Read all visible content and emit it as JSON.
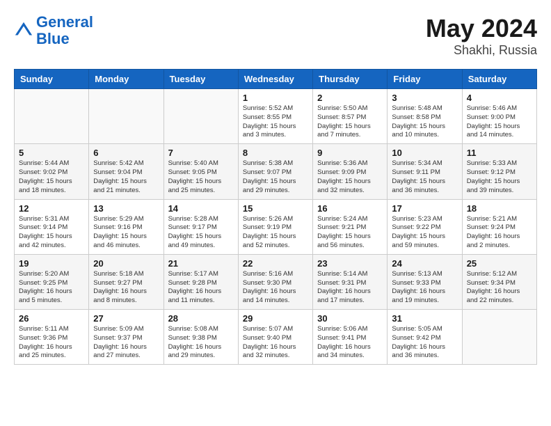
{
  "header": {
    "logo_line1": "General",
    "logo_line2": "Blue",
    "month": "May 2024",
    "location": "Shakhi, Russia"
  },
  "weekdays": [
    "Sunday",
    "Monday",
    "Tuesday",
    "Wednesday",
    "Thursday",
    "Friday",
    "Saturday"
  ],
  "weeks": [
    [
      {
        "day": "",
        "info": ""
      },
      {
        "day": "",
        "info": ""
      },
      {
        "day": "",
        "info": ""
      },
      {
        "day": "1",
        "info": "Sunrise: 5:52 AM\nSunset: 8:55 PM\nDaylight: 15 hours\nand 3 minutes."
      },
      {
        "day": "2",
        "info": "Sunrise: 5:50 AM\nSunset: 8:57 PM\nDaylight: 15 hours\nand 7 minutes."
      },
      {
        "day": "3",
        "info": "Sunrise: 5:48 AM\nSunset: 8:58 PM\nDaylight: 15 hours\nand 10 minutes."
      },
      {
        "day": "4",
        "info": "Sunrise: 5:46 AM\nSunset: 9:00 PM\nDaylight: 15 hours\nand 14 minutes."
      }
    ],
    [
      {
        "day": "5",
        "info": "Sunrise: 5:44 AM\nSunset: 9:02 PM\nDaylight: 15 hours\nand 18 minutes."
      },
      {
        "day": "6",
        "info": "Sunrise: 5:42 AM\nSunset: 9:04 PM\nDaylight: 15 hours\nand 21 minutes."
      },
      {
        "day": "7",
        "info": "Sunrise: 5:40 AM\nSunset: 9:05 PM\nDaylight: 15 hours\nand 25 minutes."
      },
      {
        "day": "8",
        "info": "Sunrise: 5:38 AM\nSunset: 9:07 PM\nDaylight: 15 hours\nand 29 minutes."
      },
      {
        "day": "9",
        "info": "Sunrise: 5:36 AM\nSunset: 9:09 PM\nDaylight: 15 hours\nand 32 minutes."
      },
      {
        "day": "10",
        "info": "Sunrise: 5:34 AM\nSunset: 9:11 PM\nDaylight: 15 hours\nand 36 minutes."
      },
      {
        "day": "11",
        "info": "Sunrise: 5:33 AM\nSunset: 9:12 PM\nDaylight: 15 hours\nand 39 minutes."
      }
    ],
    [
      {
        "day": "12",
        "info": "Sunrise: 5:31 AM\nSunset: 9:14 PM\nDaylight: 15 hours\nand 42 minutes."
      },
      {
        "day": "13",
        "info": "Sunrise: 5:29 AM\nSunset: 9:16 PM\nDaylight: 15 hours\nand 46 minutes."
      },
      {
        "day": "14",
        "info": "Sunrise: 5:28 AM\nSunset: 9:17 PM\nDaylight: 15 hours\nand 49 minutes."
      },
      {
        "day": "15",
        "info": "Sunrise: 5:26 AM\nSunset: 9:19 PM\nDaylight: 15 hours\nand 52 minutes."
      },
      {
        "day": "16",
        "info": "Sunrise: 5:24 AM\nSunset: 9:21 PM\nDaylight: 15 hours\nand 56 minutes."
      },
      {
        "day": "17",
        "info": "Sunrise: 5:23 AM\nSunset: 9:22 PM\nDaylight: 15 hours\nand 59 minutes."
      },
      {
        "day": "18",
        "info": "Sunrise: 5:21 AM\nSunset: 9:24 PM\nDaylight: 16 hours\nand 2 minutes."
      }
    ],
    [
      {
        "day": "19",
        "info": "Sunrise: 5:20 AM\nSunset: 9:25 PM\nDaylight: 16 hours\nand 5 minutes."
      },
      {
        "day": "20",
        "info": "Sunrise: 5:18 AM\nSunset: 9:27 PM\nDaylight: 16 hours\nand 8 minutes."
      },
      {
        "day": "21",
        "info": "Sunrise: 5:17 AM\nSunset: 9:28 PM\nDaylight: 16 hours\nand 11 minutes."
      },
      {
        "day": "22",
        "info": "Sunrise: 5:16 AM\nSunset: 9:30 PM\nDaylight: 16 hours\nand 14 minutes."
      },
      {
        "day": "23",
        "info": "Sunrise: 5:14 AM\nSunset: 9:31 PM\nDaylight: 16 hours\nand 17 minutes."
      },
      {
        "day": "24",
        "info": "Sunrise: 5:13 AM\nSunset: 9:33 PM\nDaylight: 16 hours\nand 19 minutes."
      },
      {
        "day": "25",
        "info": "Sunrise: 5:12 AM\nSunset: 9:34 PM\nDaylight: 16 hours\nand 22 minutes."
      }
    ],
    [
      {
        "day": "26",
        "info": "Sunrise: 5:11 AM\nSunset: 9:36 PM\nDaylight: 16 hours\nand 25 minutes."
      },
      {
        "day": "27",
        "info": "Sunrise: 5:09 AM\nSunset: 9:37 PM\nDaylight: 16 hours\nand 27 minutes."
      },
      {
        "day": "28",
        "info": "Sunrise: 5:08 AM\nSunset: 9:38 PM\nDaylight: 16 hours\nand 29 minutes."
      },
      {
        "day": "29",
        "info": "Sunrise: 5:07 AM\nSunset: 9:40 PM\nDaylight: 16 hours\nand 32 minutes."
      },
      {
        "day": "30",
        "info": "Sunrise: 5:06 AM\nSunset: 9:41 PM\nDaylight: 16 hours\nand 34 minutes."
      },
      {
        "day": "31",
        "info": "Sunrise: 5:05 AM\nSunset: 9:42 PM\nDaylight: 16 hours\nand 36 minutes."
      },
      {
        "day": "",
        "info": ""
      }
    ]
  ]
}
